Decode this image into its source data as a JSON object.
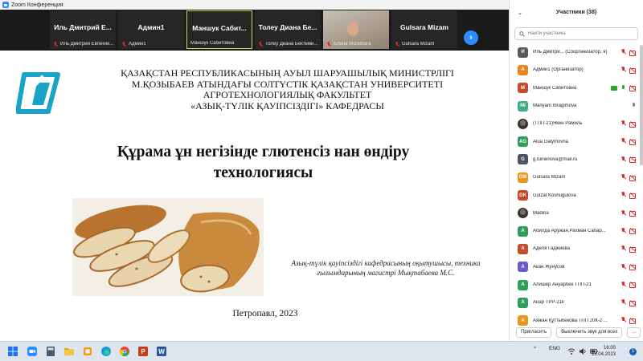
{
  "window": {
    "title": "Zoom Конференция"
  },
  "tiles": [
    {
      "name": "Иль Дмитрий Е...",
      "label": "Иль Дмитрий Евгение...",
      "muted": true
    },
    {
      "name": "Админ1",
      "label": "Админ1",
      "muted": true
    },
    {
      "name": "Маншук Сабит...",
      "label": "Маншук Сабитовна",
      "muted": false
    },
    {
      "name": "Толеу Диана Бе...",
      "label": "Толеу Диана Бектеми...",
      "muted": true
    },
    {
      "name": "",
      "label": "Елена Молибога",
      "muted": true
    },
    {
      "name": "Gulsara Mizam",
      "label": "Gulsara Mizam",
      "muted": true
    }
  ],
  "slide": {
    "univ_lines": [
      "ҚАЗАҚСТАН РЕСПУБЛИКАСЫНЫҢ АУЫЛ ШАРУАШЫЛЫҚ МИНИСТРЛІГІ",
      "М.ҚОЗЫБАЕВ АТЫНДАҒЫ СОЛТҮСТІК ҚАЗАҚСТАН УНИВЕРСИТЕТІ",
      "АГРОТЕХНОЛОГИЯЛЫҚ ФАКУЛЬТЕТ",
      "«АЗЫҚ-ТҮЛІК ҚАУІПСІЗДІГІ» КАФЕДРАСЫ"
    ],
    "title_lines": [
      "Құрама ұн негізінде глютенсіз нан өндіру",
      "технологиясы"
    ],
    "author_lines": [
      "Азық-түлік қауіпсіздігі кафедрасының оқытушысы, техника",
      "ғылымдарының магистрі Мықтабаева М.С."
    ],
    "city": "Петропавл, 2023"
  },
  "panel": {
    "title": "Участники (38)",
    "search_placeholder": "Найти участника",
    "participants": [
      {
        "initials": "И",
        "color": "#5a5a5a",
        "name": "Иль Дмитри... (Соорганизатор, я)",
        "mic": "off",
        "cam": "off"
      },
      {
        "initials": "А",
        "color": "#e8861e",
        "name": "Админ1 (Организатор)",
        "mic": "off",
        "cam": "off"
      },
      {
        "initials": "М",
        "color": "#c64a2c",
        "name": "Маншук Сабитовна",
        "mic": "on",
        "cam": "off",
        "chat": true
      },
      {
        "initials": "MI",
        "color": "#3eab8a",
        "name": "Mariyam Ibragimova",
        "mic": "gray",
        "cam": "none"
      },
      {
        "initials": "",
        "color": "photo",
        "name": "(ТПП-21)Якин Рамиль",
        "mic": "off",
        "cam": "off"
      },
      {
        "initials": "AG",
        "color": "#2e9e5b",
        "name": "Alua Galymovna",
        "mic": "off",
        "cam": "off"
      },
      {
        "initials": "G",
        "color": "#4a5560",
        "name": "g.tumenova@mail.ru",
        "mic": "off",
        "cam": "off"
      },
      {
        "initials": "GM",
        "color": "#e8961e",
        "name": "Gulsara Mizam",
        "mic": "off",
        "cam": "off"
      },
      {
        "initials": "GK",
        "color": "#c64a2c",
        "name": "Gulzat Koshugulova",
        "mic": "off",
        "cam": "off"
      },
      {
        "initials": "",
        "color": "photo",
        "name": "Madina",
        "mic": "off",
        "cam": "off"
      },
      {
        "initials": "А",
        "color": "#2e9e5b",
        "name": "Абилда Аружан,Рахман Сапар...",
        "mic": "off",
        "cam": "off"
      },
      {
        "initials": "А",
        "color": "#c64a2c",
        "name": "Аделя Гаджиева",
        "mic": "off",
        "cam": "off"
      },
      {
        "initials": "А",
        "color": "#6a5acd",
        "name": "Акан Жунусов",
        "mic": "off",
        "cam": "off"
      },
      {
        "initials": "А",
        "color": "#2e9e5b",
        "name": "Алишер Ануарбек ТПП-21",
        "mic": "off",
        "cam": "off"
      },
      {
        "initials": "А",
        "color": "#2e9e5b",
        "name": "Анар ТРР-21k",
        "mic": "off",
        "cam": "off"
      },
      {
        "initials": "А",
        "color": "#e8961e",
        "name": "Аяжан Құттыбекова ТПП 20К-2 ...",
        "mic": "off",
        "cam": "off"
      }
    ],
    "invite_label": "Пригласить",
    "mute_all_label": "Выключить звук для всех",
    "more_label": "..."
  },
  "taskbar": {
    "lang": "ENG",
    "time": "16:00",
    "date": "13.04.2023",
    "notif_count": "1"
  }
}
